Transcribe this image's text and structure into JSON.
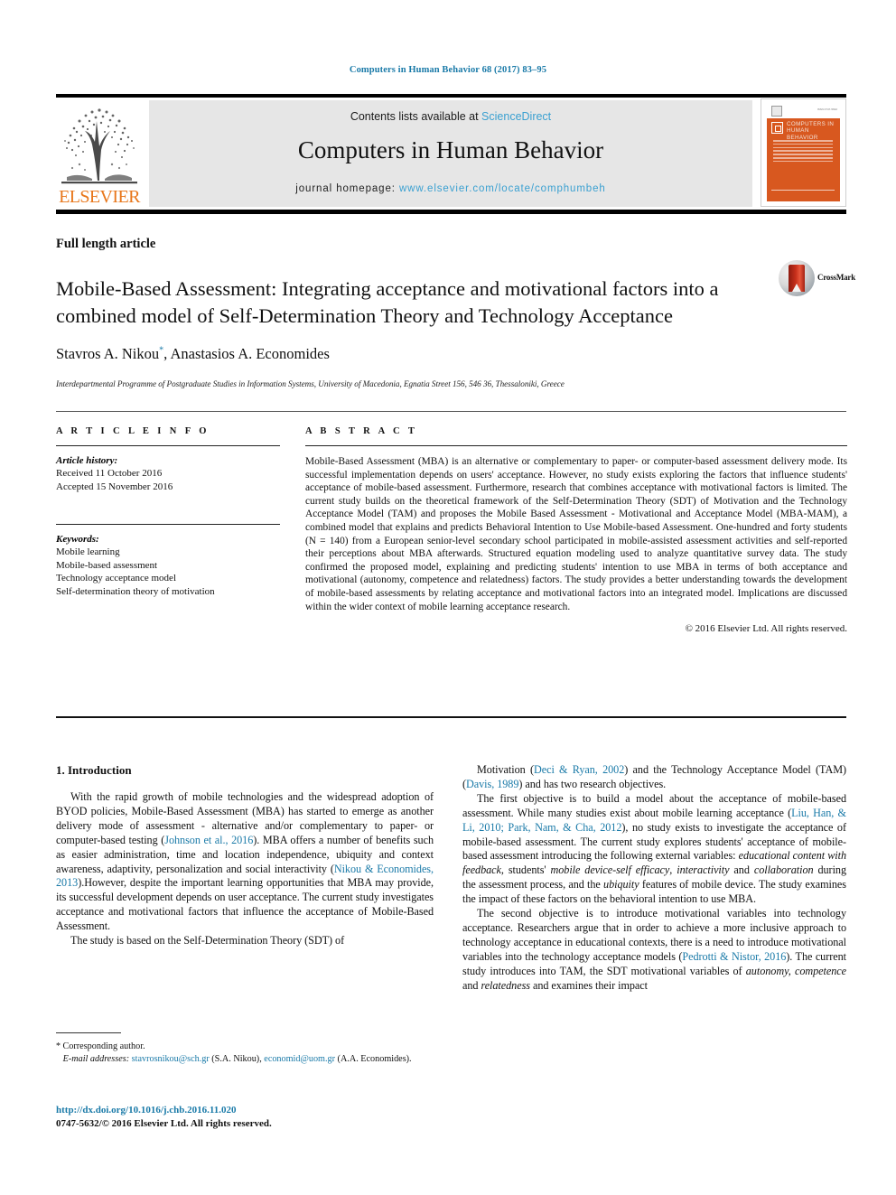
{
  "running_head": "Computers in Human Behavior 68 (2017) 83–95",
  "masthead": {
    "publisher_name": "ELSEVIER",
    "contents_prefix": "Contents lists available at ",
    "contents_link": "ScienceDirect",
    "journal_title": "Computers in Human Behavior",
    "homepage_prefix": "journal homepage: ",
    "homepage_url": "www.elsevier.com/locate/comphumbeh",
    "cover": {
      "title": "COMPUTERS IN HUMAN BEHAVIOR",
      "corner_note": "ISSN 0747-5632"
    }
  },
  "article": {
    "type": "Full length article",
    "title": "Mobile-Based Assessment: Integrating acceptance and motivational factors into a combined model of Self-Determination Theory and Technology Acceptance",
    "authors": "Stavros A. Nikou",
    "author_marker": "*",
    "authors_rest": ", Anastasios A. Economides",
    "affiliation": "Interdepartmental Programme of Postgraduate Studies in Information Systems, University of Macedonia, Egnatia Street 156, 546 36, Thessaloniki, Greece",
    "crossmark_label": "CrossMark"
  },
  "article_info": {
    "heading": "A R T I C L E  I N F O",
    "history_heading": "Article history:",
    "history": [
      "Received 11 October 2016",
      "Accepted 15 November 2016"
    ],
    "keywords_heading": "Keywords:",
    "keywords": [
      "Mobile learning",
      "Mobile-based assessment",
      "Technology acceptance model",
      "Self-determination theory of motivation"
    ]
  },
  "abstract": {
    "heading": "A B S T R A C T",
    "text": "Mobile-Based Assessment (MBA) is an alternative or complementary to paper- or computer-based assessment delivery mode. Its successful implementation depends on users' acceptance. However, no study exists exploring the factors that influence students' acceptance of mobile-based assessment. Furthermore, research that combines acceptance with motivational factors is limited. The current study builds on the theoretical framework of the Self-Determination Theory (SDT) of Motivation and the Technology Acceptance Model (TAM) and proposes the Mobile Based Assessment - Motivational and Acceptance Model (MBA-MAM), a combined model that explains and predicts Behavioral Intention to Use Mobile-based Assessment. One-hundred and forty students (N = 140) from a European senior-level secondary school participated in mobile-assisted assessment activities and self-reported their perceptions about MBA afterwards. Structured equation modeling used to analyze quantitative survey data. The study confirmed the proposed model, explaining and predicting students' intention to use MBA in terms of both acceptance and motivational (autonomy, competence and relatedness) factors. The study provides a better understanding towards the development of mobile-based assessments by relating acceptance and motivational factors into an integrated model. Implications are discussed within the wider context of mobile learning acceptance research.",
    "copyright": "© 2016 Elsevier Ltd. All rights reserved."
  },
  "body": {
    "section_number_title": "1. Introduction",
    "left_paragraphs": [
      {
        "segments": [
          {
            "t": "With the rapid growth of mobile technologies and the widespread adoption of BYOD policies, Mobile-Based Assessment (MBA) has started to emerge as another delivery mode of assessment - alternative and/or complementary to paper- or computer-based testing (",
            "s": "plain"
          },
          {
            "t": "Johnson et al., 2016",
            "s": "ref"
          },
          {
            "t": "). MBA offers a number of benefits such as easier administration, time and location independence, ubiquity and context awareness, adaptivity, personalization and social interactivity (",
            "s": "plain"
          },
          {
            "t": "Nikou & Economides, 2013",
            "s": "ref"
          },
          {
            "t": ").However, despite the important learning opportunities that MBA may provide, its successful development depends on user acceptance. The current study investigates acceptance and motivational factors that influence the acceptance of Mobile-Based Assessment.",
            "s": "plain"
          }
        ]
      },
      {
        "segments": [
          {
            "t": "The study is based on the Self-Determination Theory (SDT) of",
            "s": "plain"
          }
        ]
      }
    ],
    "right_paragraphs": [
      {
        "segments": [
          {
            "t": "Motivation (",
            "s": "plain"
          },
          {
            "t": "Deci & Ryan, 2002",
            "s": "ref"
          },
          {
            "t": ") and the Technology Acceptance Model (TAM) (",
            "s": "plain"
          },
          {
            "t": "Davis, 1989",
            "s": "ref"
          },
          {
            "t": ") and has two research objectives.",
            "s": "plain"
          }
        ],
        "no_indent": false
      },
      {
        "segments": [
          {
            "t": "The first objective is to build a model about the acceptance of mobile-based assessment. While many studies exist about mobile learning acceptance (",
            "s": "plain"
          },
          {
            "t": "Liu, Han, & Li, 2010; Park, Nam, & Cha, 2012",
            "s": "ref"
          },
          {
            "t": "), no study exists to investigate the acceptance of mobile-based assessment. The current study explores students' acceptance of mobile-based assessment introducing the following external variables: ",
            "s": "plain"
          },
          {
            "t": "educational content with feedback",
            "s": "it"
          },
          {
            "t": ", students' ",
            "s": "plain"
          },
          {
            "t": "mobile device-self efficacy",
            "s": "it"
          },
          {
            "t": ", ",
            "s": "plain"
          },
          {
            "t": "interactivity",
            "s": "it"
          },
          {
            "t": " and ",
            "s": "plain"
          },
          {
            "t": "collaboration",
            "s": "it"
          },
          {
            "t": " during the assessment process, and the ",
            "s": "plain"
          },
          {
            "t": "ubiquity",
            "s": "it"
          },
          {
            "t": " features of mobile device. The study examines the impact of these factors on the behavioral intention to use MBA.",
            "s": "plain"
          }
        ]
      },
      {
        "segments": [
          {
            "t": "The second objective is to introduce motivational variables into technology acceptance. Researchers argue that in order to achieve a more inclusive approach to technology acceptance in educational contexts, there is a need to introduce motivational variables into the technology acceptance models (",
            "s": "plain"
          },
          {
            "t": "Pedrotti & Nistor, 2016",
            "s": "ref"
          },
          {
            "t": "). The current study introduces into TAM, the SDT motivational variables of ",
            "s": "plain"
          },
          {
            "t": "autonomy, competence",
            "s": "it"
          },
          {
            "t": " and ",
            "s": "plain"
          },
          {
            "t": "relatedness",
            "s": "it"
          },
          {
            "t": " and examines their impact",
            "s": "plain"
          }
        ]
      }
    ]
  },
  "footnote": {
    "corresponding": "Corresponding author.",
    "email_label": "E-mail addresses:",
    "email_1": "stavrosnikou@sch.gr",
    "email_1_owner": "(S.A. Nikou),",
    "email_2": "economid@uom.gr",
    "email_2_owner": "(A.A. Economides).",
    "doi": "http://dx.doi.org/10.1016/j.chb.2016.11.020",
    "issn_copyright": "0747-5632/© 2016 Elsevier Ltd. All rights reserved."
  },
  "colors": {
    "link": "#1a7aa8",
    "sciencedirect": "#3aa0d1",
    "elsevier_orange": "#e8761a",
    "cover_orange": "#d8581f",
    "band_gray": "#e6e6e6"
  }
}
